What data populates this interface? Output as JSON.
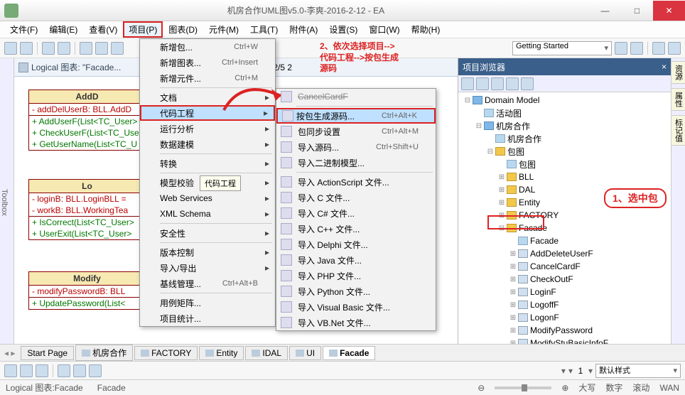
{
  "title": "机房合作UML图v5.0-李爽-2016-2-12 - EA",
  "menus": [
    "文件(F)",
    "编辑(E)",
    "查看(V)",
    "项目(P)",
    "图表(D)",
    "元件(M)",
    "工具(T)",
    "附件(A)",
    "设置(S)",
    "窗口(W)",
    "帮助(H)"
  ],
  "toolbar_combo": "Getting Started",
  "diag_label": "Logical 图表: \"Facade...",
  "date_fragment": "2016/2/5 2",
  "uml1": {
    "title": "AddD",
    "rows": [
      "- addDelUserB: BLL.AddD",
      "",
      "+ AddUserF(List<TC_User>",
      "+ CheckUserF(List<TC_User",
      "+ GetUserName(List<TC_U"
    ]
  },
  "uml2": {
    "title": "Lo",
    "rows": [
      "- loginB: BLL.LoginBLL =",
      "- workB: BLL.WorkingTea",
      "",
      "+ IsCorrect(List<TC_User>",
      "+ UserExit(List<TC_User>"
    ]
  },
  "uml3": {
    "title": "Modify",
    "rows": [
      "- modifyPasswordB: BLL",
      "",
      "+ UpdatePassword(List<"
    ]
  },
  "proj_menu": {
    "items": [
      "新增包...",
      "新增图表...",
      "新增元件...",
      "文档",
      "代码工程",
      "运行分析",
      "数据建模",
      "转换",
      "模型校验",
      "Web Services",
      "XML Schema",
      "安全性",
      "版本控制",
      "导入/导出",
      "基线管理...",
      "用例矩阵...",
      "项目统计..."
    ],
    "shortcuts": {
      "0": "Ctrl+W",
      "1": "Ctrl+Insert",
      "2": "Ctrl+M",
      "14": "Ctrl+Alt+B"
    },
    "tooltip": "代码工程"
  },
  "sub_menu": {
    "items": [
      "按包生成源码...",
      "包同步设置",
      "导入源码...",
      "导入二进制模型...",
      "导入 ActionScript 文件...",
      "导入 C 文件...",
      "导入 C# 文件...",
      "导入 C++ 文件...",
      "导入 Delphi 文件...",
      "导入 Java 文件...",
      "导入 PHP 文件...",
      "导入 Python 文件...",
      "导入 Visual Basic 文件...",
      "导入 VB.Net 文件..."
    ],
    "shortcuts": {
      "0": "Ctrl+Alt+K",
      "1": "Ctrl+Alt+M",
      "2": "Ctrl+Shift+U"
    },
    "top_cut": "CancelCardF"
  },
  "anno1": "1、选中包",
  "anno2_l1": "2、依次选择项目-->",
  "anno2_l2": "代码工程-->按包生成",
  "anno2_l3": "源码",
  "browser": {
    "title": "项目浏览器",
    "root": "Domain Model",
    "act": "活动图",
    "main": "机房合作",
    "main_d": "机房合作",
    "pkg": "包图",
    "pkg_d": "包图",
    "folders": [
      "BLL",
      "DAL",
      "Entity",
      "FACTORY",
      "Facade"
    ],
    "facade_d": "Facade",
    "classes": [
      "AddDeleteUserF",
      "CancelCardF",
      "CheckOutF",
      "LoginF",
      "LogoffF",
      "LogonF",
      "ModifyPassword",
      "ModifyStuBasicInfoF"
    ]
  },
  "bottom_tabs": [
    "Start Page",
    "机房合作",
    "FACTORY",
    "Entity",
    "IDAL",
    "UI",
    "Facade"
  ],
  "style_combo": "默认样式",
  "status": {
    "l1": "Logical 图表:Facade",
    "l2": "Facade",
    "caps": "大写",
    "num": "数字",
    "scroll": "滚动",
    "wan": "WAN"
  },
  "sidebar_tabs": [
    "资源",
    "属性",
    "标记值"
  ],
  "toolbox": "Toolbox"
}
